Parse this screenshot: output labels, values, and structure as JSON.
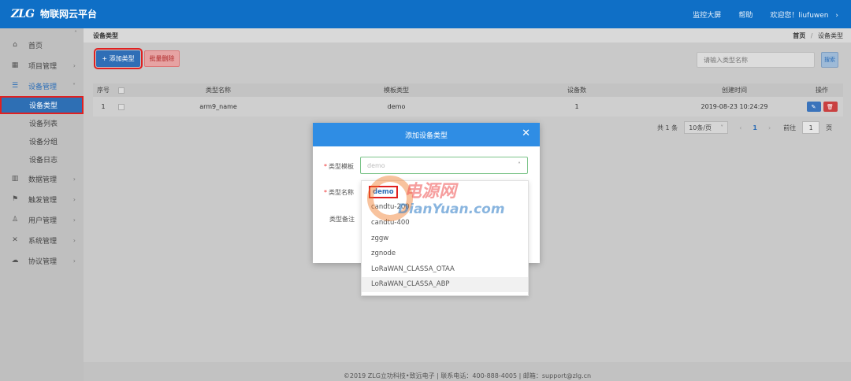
{
  "header": {
    "logo_text": "ZLG",
    "app_title": "物联网云平台",
    "nav": [
      "监控大屏",
      "帮助"
    ],
    "welcome": "欢迎您！liufuwen",
    "caret": "›"
  },
  "sidebar": {
    "collapse_glyph": "˄",
    "items": [
      {
        "label": "首页",
        "icon": "home-icon",
        "glyph": "⌂"
      },
      {
        "label": "项目管理",
        "icon": "project-icon",
        "glyph": "▦"
      },
      {
        "label": "设备管理",
        "icon": "device-icon",
        "glyph": "☰"
      },
      {
        "label": "数据管理",
        "icon": "data-icon",
        "glyph": "▥"
      },
      {
        "label": "触发管理",
        "icon": "trigger-icon",
        "glyph": "⚑"
      },
      {
        "label": "用户管理",
        "icon": "user-icon",
        "glyph": "♙"
      },
      {
        "label": "系统管理",
        "icon": "system-icon",
        "glyph": "✕"
      },
      {
        "label": "协议管理",
        "icon": "protocol-icon",
        "glyph": "☁"
      }
    ],
    "device_sub": [
      "设备类型",
      "设备列表",
      "设备分组",
      "设备日志"
    ],
    "chevron": "›",
    "chevron_open": "˅"
  },
  "page": {
    "title": "设备类型",
    "breadcrumb_home": "首页",
    "breadcrumb_sep": "/",
    "breadcrumb_current": "设备类型"
  },
  "toolbar": {
    "add_label": "+ 添加类型",
    "batch_delete_label": "批量删除",
    "search_placeholder": "请输入类型名称",
    "search_label": "搜索"
  },
  "table": {
    "columns": [
      "序号",
      "类型名称",
      "模板类型",
      "设备数",
      "创建时间",
      "操作"
    ],
    "rows": [
      {
        "no": "1",
        "name": "arm9_name",
        "template": "demo",
        "count": "1",
        "created": "2019-08-23 10:24:29"
      }
    ],
    "edit_glyph": "✎",
    "delete_glyph": "🗑"
  },
  "pagination": {
    "total": "共 1 条",
    "page_size": "10条/页",
    "prev": "‹",
    "current": "1",
    "next": "›",
    "goto_label": "前往",
    "goto_value": "1",
    "page_suffix": "页",
    "select_caret": "˅"
  },
  "modal": {
    "title": "添加设备类型",
    "close_glyph": "✕",
    "field_template_label": "类型模板",
    "field_template_placeholder": "demo",
    "field_name_label": "类型名称",
    "field_remark_label": "类型备注",
    "required_mark": "*",
    "select_caret": "˄",
    "options": [
      "demo",
      "candtu-200",
      "candtu-400",
      "zggw",
      "zgnode",
      "LoRaWAN_CLASSA_OTAA",
      "LoRaWAN_CLASSA_ABP"
    ]
  },
  "watermark": {
    "line1": "电源网",
    "line2": "DianYuan.com"
  },
  "footer": {
    "text": "©2019 ZLG立功科技•致远电子   |   联系电话：400-888-4005   |   邮箱：support@zlg.cn"
  },
  "colors": {
    "primary": "#0f6fc6",
    "modal_header": "#2f8de4",
    "highlight": "#e02020",
    "danger": "#c94040"
  }
}
